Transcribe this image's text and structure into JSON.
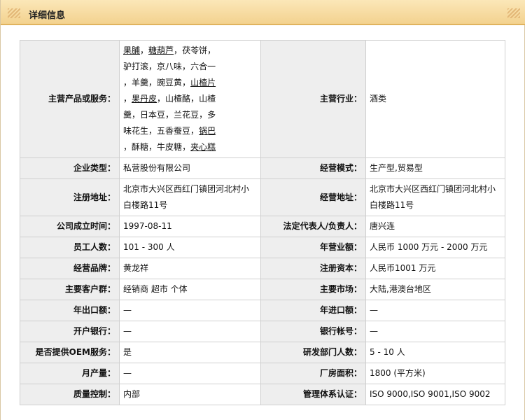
{
  "header": {
    "title": "详细信息"
  },
  "products": {
    "label": "主营产品或服务：",
    "lines": [
      [
        "果脯",
        "，",
        "糖葫芦",
        "，",
        "茯苓饼",
        "，"
      ],
      [
        "驴打滚",
        "，",
        "京八味",
        "，",
        "六合一"
      ],
      [
        "，",
        "羊羹",
        "，",
        "豌豆黄",
        "，",
        "山楂片"
      ],
      [
        "，",
        "果丹皮",
        "，",
        "山楂酪",
        "，",
        "山楂"
      ],
      [
        "羹",
        "，",
        "日本豆",
        "，",
        "兰花豆",
        "，",
        "多"
      ],
      [
        "味花生",
        "，",
        "五香蚕豆",
        "，",
        "锅巴"
      ],
      [
        "，",
        "酥糖",
        "，",
        "牛皮糖",
        "，",
        "夹心糕"
      ]
    ]
  },
  "industry": {
    "label": "主营行业：",
    "value": "酒类"
  },
  "rows": [
    {
      "l1": "企业类型：",
      "v1": "私营股份有限公司",
      "l2": "经营模式：",
      "v2": "生产型,贸易型"
    },
    {
      "l1": "注册地址：",
      "v1": "北京市大兴区西红门镇团河北村小白楼路11号",
      "l2": "经营地址：",
      "v2": "北京市大兴区西红门镇团河北村小白楼路11号"
    },
    {
      "l1": "公司成立时间：",
      "v1": "1997-08-11",
      "l2": "法定代表人/负责人：",
      "v2": "唐兴连"
    },
    {
      "l1": "员工人数：",
      "v1": "101 - 300 人",
      "l2": "年营业额：",
      "v2": "人民币 1000 万元 - 2000 万元"
    },
    {
      "l1": "经营品牌：",
      "v1": "黄龙祥",
      "l2": "注册资本：",
      "v2": "人民币1001 万元"
    },
    {
      "l1": "主要客户群：",
      "v1": "经销商 超市 个体",
      "l2": "主要市场：",
      "v2": "大陆,港澳台地区"
    },
    {
      "l1": "年出口额：",
      "v1": "—",
      "l2": "年进口额：",
      "v2": "—"
    },
    {
      "l1": "开户银行：",
      "v1": "—",
      "l2": "银行帐号：",
      "v2": "—"
    },
    {
      "l1": "是否提供OEM服务：",
      "v1": "是",
      "l2": "研发部门人数：",
      "v2": "5 - 10 人"
    },
    {
      "l1": "月产量：",
      "v1": "—",
      "l2": "厂房面积：",
      "v2": "1800 (平方米)"
    },
    {
      "l1": "质量控制：",
      "v1": "内部",
      "l2": "管理体系认证：",
      "v2": "ISO 9000,ISO 9001,ISO 9002"
    }
  ]
}
